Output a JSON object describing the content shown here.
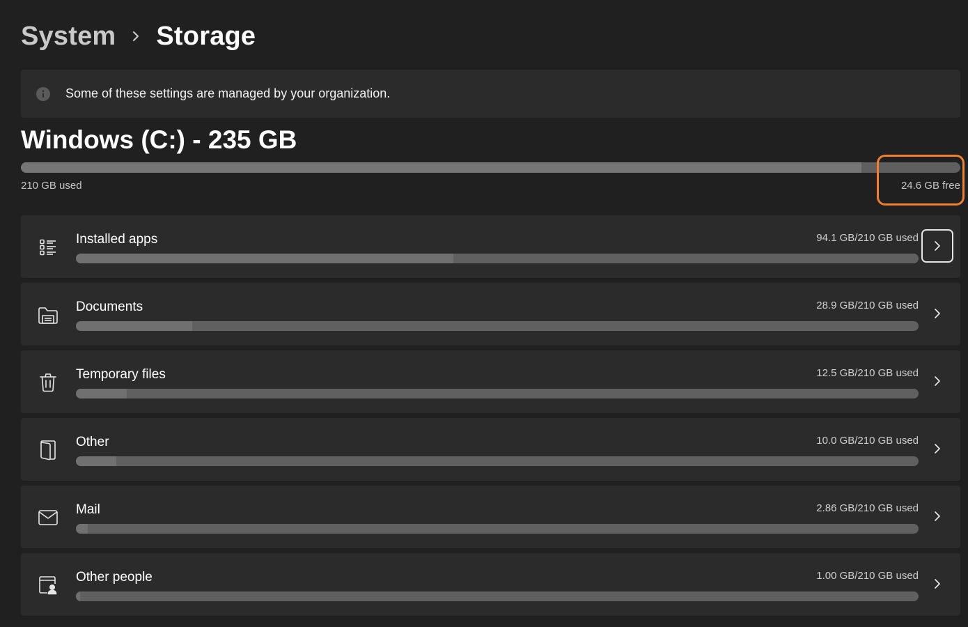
{
  "breadcrumb": {
    "parent": "System",
    "current": "Storage"
  },
  "notice": {
    "text": "Some of these settings are managed by your organization."
  },
  "drive": {
    "title": "Windows (C:) - 235 GB",
    "used_label": "210 GB used",
    "free_label": "24.6 GB free",
    "used_fraction": 0.895
  },
  "categories": [
    {
      "label": "Installed apps",
      "value": "94.1 GB/210 GB used",
      "fraction": 0.448,
      "icon": "apps-list-icon"
    },
    {
      "label": "Documents",
      "value": "28.9 GB/210 GB used",
      "fraction": 0.138,
      "icon": "documents-folder-icon"
    },
    {
      "label": "Temporary files",
      "value": "12.5 GB/210 GB used",
      "fraction": 0.06,
      "icon": "trash-icon"
    },
    {
      "label": "Other",
      "value": "10.0 GB/210 GB used",
      "fraction": 0.048,
      "icon": "other-files-icon"
    },
    {
      "label": "Mail",
      "value": "2.86 GB/210 GB used",
      "fraction": 0.014,
      "icon": "mail-icon"
    },
    {
      "label": "Other people",
      "value": "1.00 GB/210 GB used",
      "fraction": 0.005,
      "icon": "other-people-icon"
    }
  ],
  "colors": {
    "background": "#202020",
    "card": "#2b2b2b",
    "highlight": "#f07f2e"
  }
}
